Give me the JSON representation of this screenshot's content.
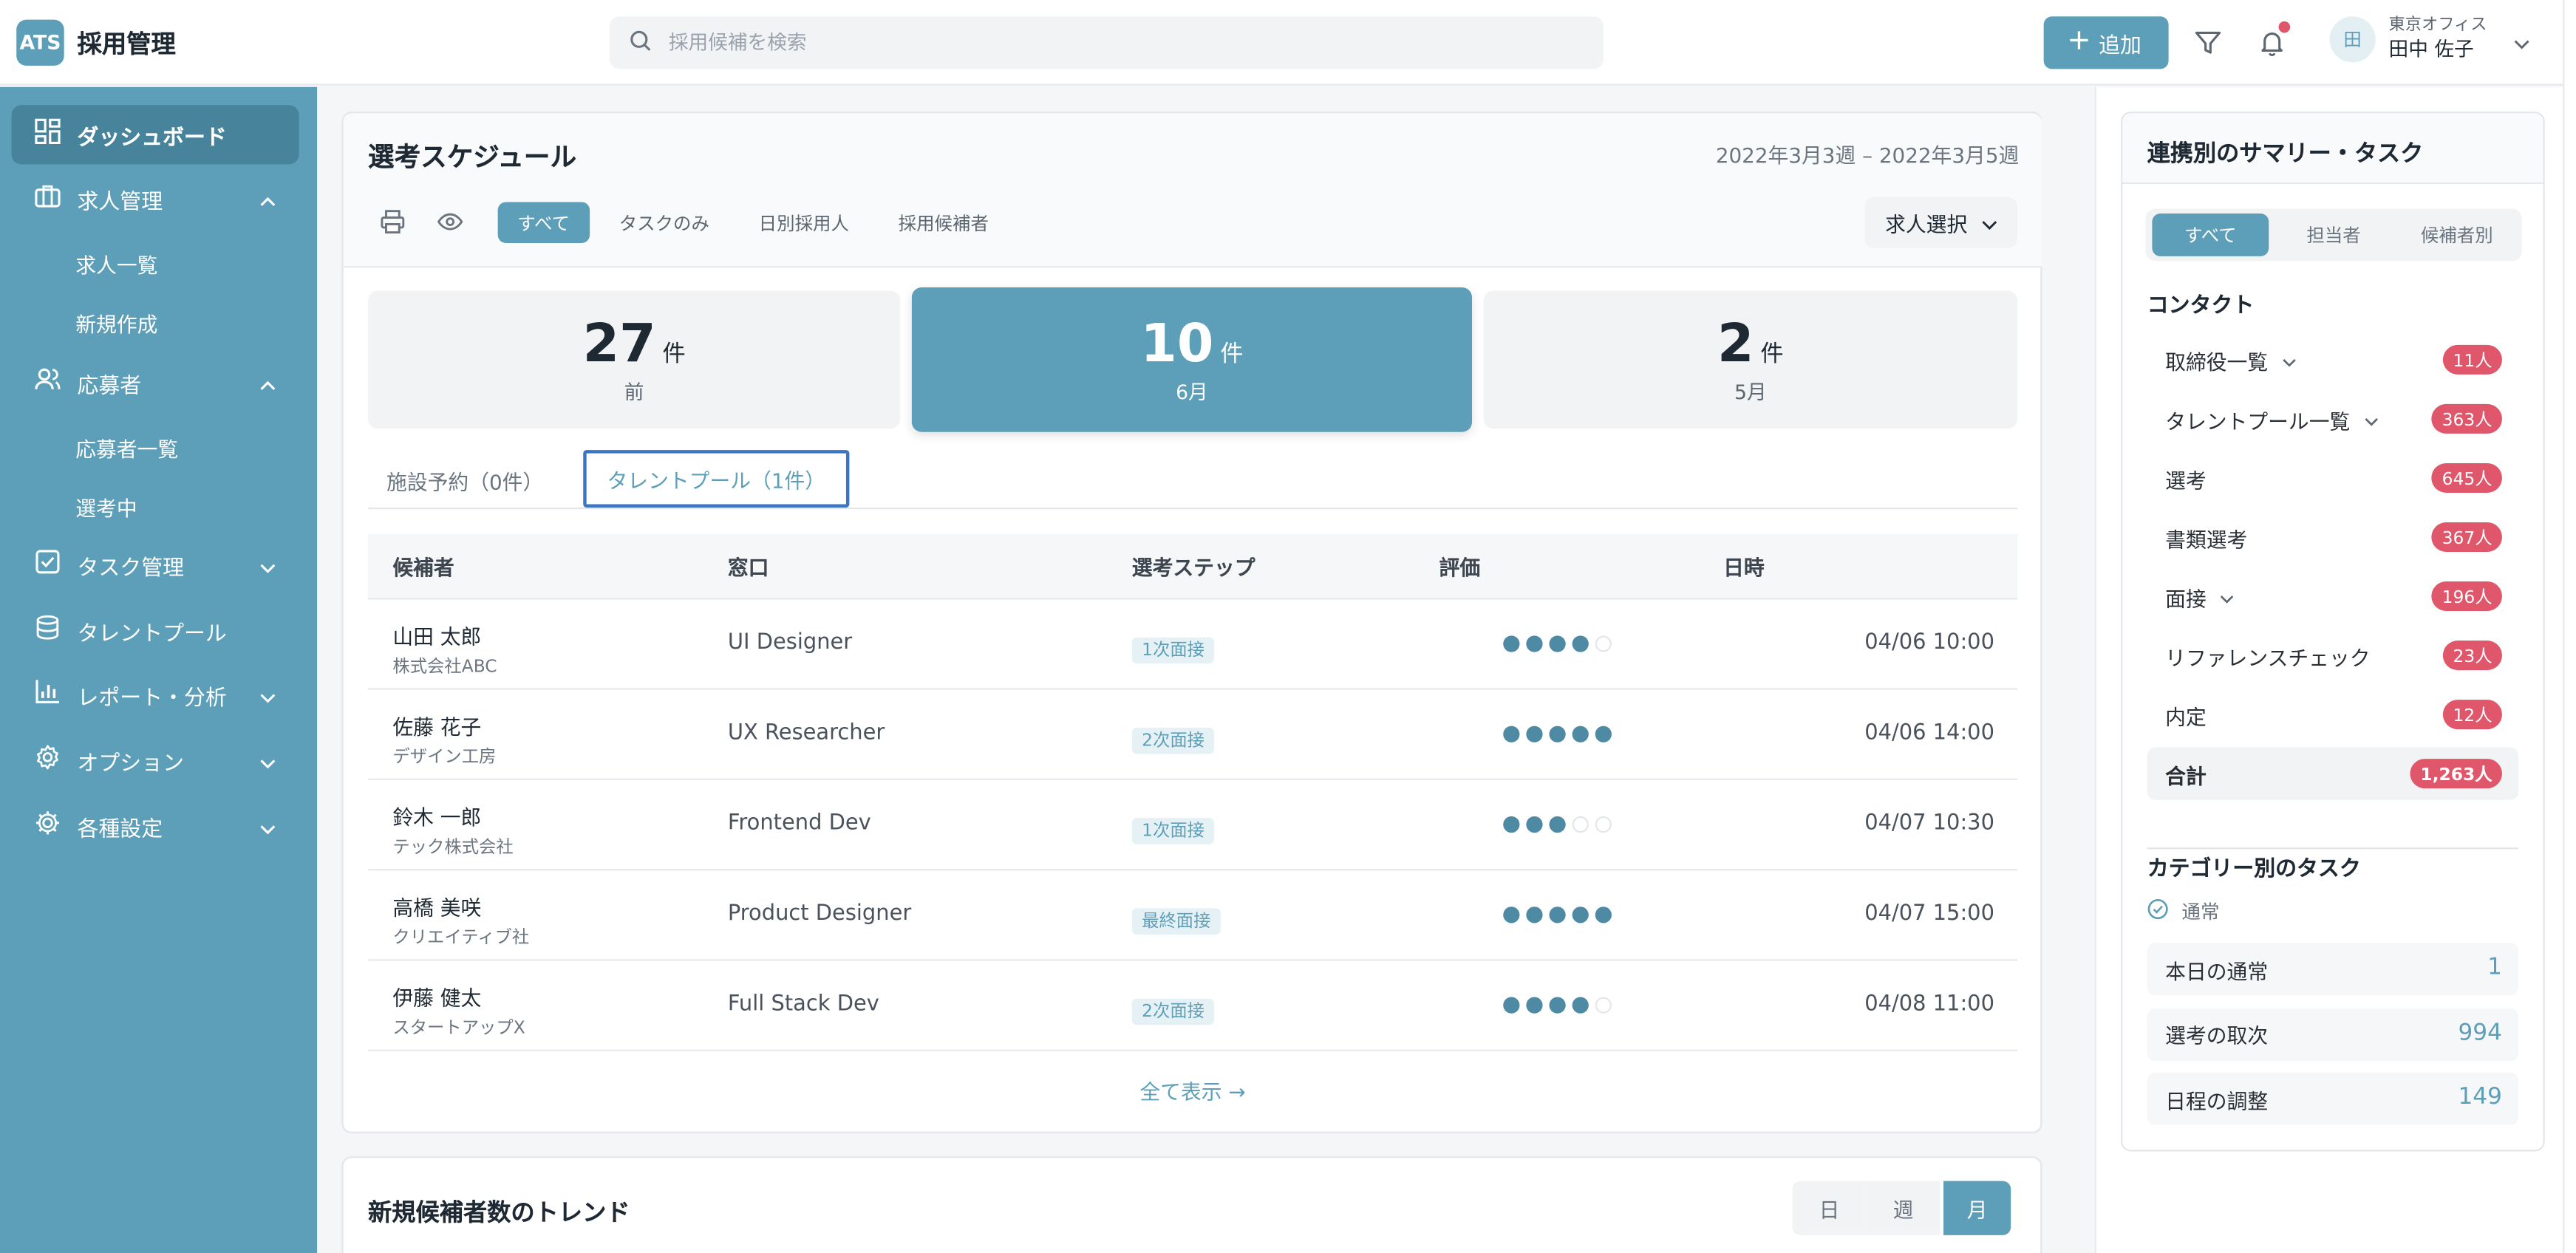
{
  "header": {
    "logo_badge": "ATS",
    "app_title": "採用管理",
    "search_placeholder": "採用候補を検索",
    "add_label": "追加",
    "user_office": "東京オフィス",
    "user_name": "田中 佐子",
    "avatar_char": "田"
  },
  "sidebar": {
    "dashboard": "ダッシュボード",
    "jobs": "求人管理",
    "jobs_list": "求人一覧",
    "jobs_new": "新規作成",
    "applicants": "応募者",
    "applicants_list": "応募者一覧",
    "in_selection": "選考中",
    "tasks": "タスク管理",
    "talent_pool": "タレントプール",
    "reports": "レポート・分析",
    "options": "オプション",
    "settings": "各種設定"
  },
  "schedule": {
    "title": "選考スケジュール",
    "range": "2022年3月3週 – 2022年3月5週",
    "tabs": [
      "すべて",
      "タスクのみ",
      "日別採用人",
      "採用候補者"
    ],
    "job_select": "求人選択",
    "stats": [
      {
        "num": "27",
        "unit": "件",
        "label": "前"
      },
      {
        "num": "10",
        "unit": "件",
        "label": "6月"
      },
      {
        "num": "2",
        "unit": "件",
        "label": "5月"
      }
    ],
    "sub_tabs": [
      "施設予約（0件）",
      "タレントプール（1件）"
    ],
    "columns": [
      "候補者",
      "窓口",
      "選考ステップ",
      "評価",
      "日時"
    ],
    "rows": [
      {
        "name": "山田 太郎",
        "company": "株式会社ABC",
        "role": "UI Designer",
        "step": "1次面接",
        "rating": 4,
        "date": "04/06 10:00"
      },
      {
        "name": "佐藤 花子",
        "company": "デザイン工房",
        "role": "UX Researcher",
        "step": "2次面接",
        "rating": 5,
        "date": "04/06 14:00"
      },
      {
        "name": "鈴木 一郎",
        "company": "テック株式会社",
        "role": "Frontend Dev",
        "step": "1次面接",
        "rating": 3,
        "date": "04/07 10:30"
      },
      {
        "name": "高橋 美咲",
        "company": "クリエイティブ社",
        "role": "Product Designer",
        "step": "最終面接",
        "rating": 5,
        "date": "04/07 15:00"
      },
      {
        "name": "伊藤 健太",
        "company": "スタートアップX",
        "role": "Full Stack Dev",
        "step": "2次面接",
        "rating": 4,
        "date": "04/08 11:00"
      }
    ],
    "view_all": "全て表示 →"
  },
  "trend": {
    "title": "新規候補者数のトレンド",
    "periods": [
      "日",
      "週",
      "月"
    ]
  },
  "summary": {
    "title": "連携別のサマリー・タスク",
    "tabs": [
      "すべて",
      "担当者",
      "候補者別"
    ],
    "contact_heading": "コンタクト",
    "items": [
      {
        "label": "取締役一覧",
        "count": "11人"
      },
      {
        "label": "タレントプール一覧",
        "count": "363人"
      },
      {
        "label": "選考",
        "count": "645人"
      },
      {
        "label": "書類選考",
        "count": "367人"
      },
      {
        "label": "面接",
        "count": "196人"
      },
      {
        "label": "リファレンスチェック",
        "count": "23人"
      },
      {
        "label": "内定",
        "count": "12人"
      },
      {
        "label": "合計",
        "count": "1,263人"
      }
    ],
    "task_heading": "カテゴリー別のタスク",
    "task_type": "通常",
    "tasks": [
      {
        "label": "本日の通常",
        "count": "1"
      },
      {
        "label": "選考の取次",
        "count": "994"
      },
      {
        "label": "日程の調整",
        "count": "149"
      }
    ]
  },
  "colors": {
    "accent": "#5d9fb8",
    "badge": "#e0566a"
  }
}
